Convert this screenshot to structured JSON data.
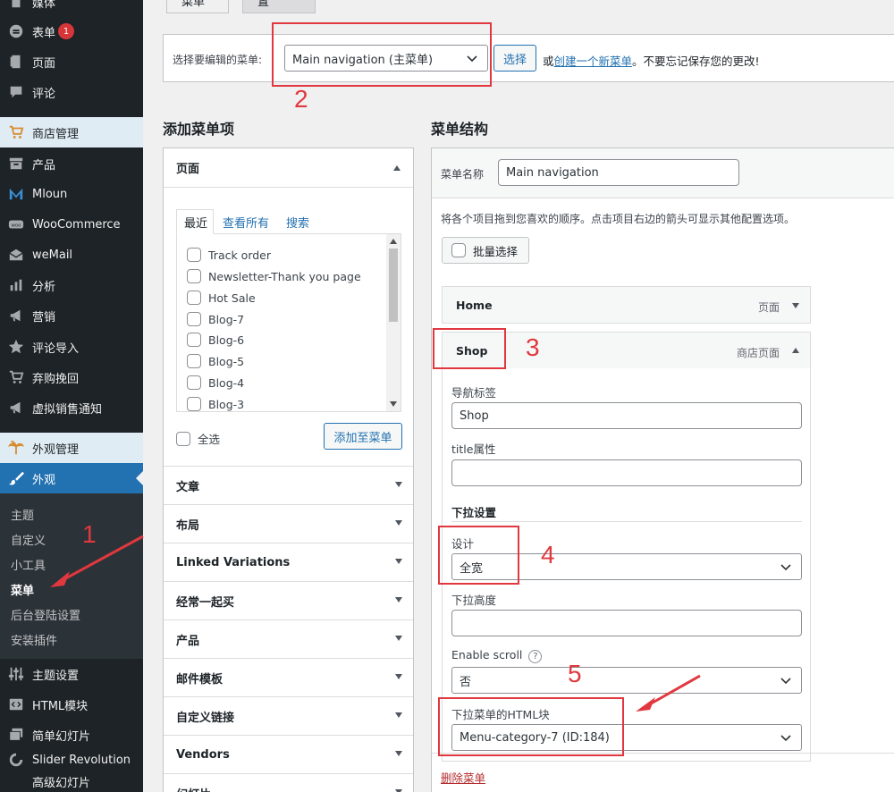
{
  "sidebar": {
    "items": [
      {
        "label": "媒体",
        "icon": "media-icon"
      },
      {
        "label": "表单",
        "icon": "forms-icon",
        "badge": "1"
      },
      {
        "label": "页面",
        "icon": "page-icon"
      },
      {
        "label": "评论",
        "icon": "comment-icon"
      },
      {
        "label": "商店管理",
        "icon": "cart-icon"
      },
      {
        "label": "产品",
        "icon": "archive-icon"
      },
      {
        "label": "Mloun",
        "icon": "mloun-icon"
      },
      {
        "label": "WooCommerce",
        "icon": "woo-icon"
      },
      {
        "label": "weMail",
        "icon": "mail-icon"
      },
      {
        "label": "分析",
        "icon": "chart-bar-icon"
      },
      {
        "label": "营销",
        "icon": "megaphone-icon"
      },
      {
        "label": "评论导入",
        "icon": "star-icon"
      },
      {
        "label": "弃购挽回",
        "icon": "cart-icon"
      },
      {
        "label": "虚拟销售通知",
        "icon": "megaphone-icon"
      },
      {
        "label": "外观管理",
        "icon": "palm-icon"
      },
      {
        "label": "外观",
        "icon": "brush-icon"
      },
      {
        "label": "主题设置",
        "icon": "sliders-icon"
      },
      {
        "label": "HTML模块",
        "icon": "html-icon"
      },
      {
        "label": "简单幻灯片",
        "icon": "slides-icon"
      },
      {
        "label": "Slider Revolution",
        "icon": "revolution-icon"
      },
      {
        "label": "高级幻灯片",
        "icon": ""
      }
    ],
    "submenu": [
      "主题",
      "自定义",
      "小工具",
      "菜单",
      "后台登陆设置",
      "安装插件"
    ]
  },
  "tabs": {
    "edit": "编辑菜单",
    "manage": "管理位置"
  },
  "select_bar": {
    "label": "选择要编辑的菜单:",
    "selected": "Main navigation (主菜单)",
    "button": "选择",
    "or": "或",
    "create_link": "创建一个新菜单",
    "note": "。不要忘记保存您的更改!"
  },
  "add_items": {
    "title": "添加菜单项",
    "pages_section": "页面",
    "tabs": [
      "最近",
      "查看所有",
      "搜索"
    ],
    "pages": [
      "Track order",
      "Newsletter-Thank you page",
      "Hot Sale",
      "Blog-7",
      "Blog-6",
      "Blog-5",
      "Blog-4",
      "Blog-3"
    ],
    "select_all": "全选",
    "add_button": "添加至菜单",
    "sections": [
      "文章",
      "布局",
      "Linked Variations",
      "经常一起买",
      "产品",
      "邮件模板",
      "自定义链接",
      "Vendors",
      "幻灯片"
    ]
  },
  "structure": {
    "title": "菜单结构",
    "name_label": "菜单名称",
    "name_value": "Main navigation",
    "hint": "将各个项目拖到您喜欢的顺序。点击项目右边的箭头可显示其他配置选项。",
    "bulk_select": "批量选择",
    "items": [
      {
        "title": "Home",
        "type": "页面"
      },
      {
        "title": "Shop",
        "type": "商店页面"
      }
    ],
    "settings": {
      "nav_label": "导航标签",
      "nav_value": "Shop",
      "title_attr": "title属性",
      "title_attr_value": "",
      "dropdown_heading": "下拉设置",
      "design_label": "设计",
      "design_value": "全宽",
      "height_label": "下拉高度",
      "height_value": "",
      "scroll_label": "Enable scroll",
      "scroll_help": "?",
      "scroll_value": "否",
      "html_block_label": "下拉菜单的HTML块",
      "html_block_value": "Menu-category-7 (ID:184)"
    },
    "delete_link": "删除菜单"
  },
  "annotations": [
    "1",
    "2",
    "3",
    "4",
    "5"
  ],
  "colors": {
    "annotation": "#e0383e",
    "accent": "#2271b1",
    "sidebar": "#1d2327"
  }
}
